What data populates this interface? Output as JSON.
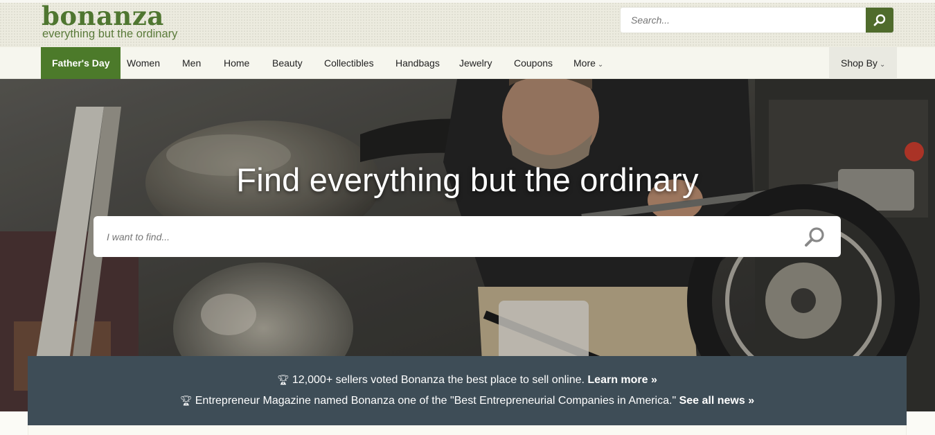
{
  "header": {
    "logo_word": "bonanza",
    "logo_tagline": "everything but the ordinary",
    "search_placeholder": "Search...",
    "search_button_icon": "search-icon"
  },
  "nav": {
    "items": [
      "Father's Day",
      "Women",
      "Men",
      "Home",
      "Beauty",
      "Collectibles",
      "Handbags",
      "Jewelry",
      "Coupons",
      "More"
    ],
    "shop_by": "Shop By"
  },
  "hero": {
    "title": "Find everything but the ordinary",
    "search_placeholder": "I want to find..."
  },
  "banner": {
    "line1_text": "12,000+ sellers voted Bonanza the best place to sell online.",
    "line1_link": "Learn more »",
    "line2_text": "Entrepreneur Magazine named Bonanza one of the \"Best Entrepreneurial Companies in America.\"",
    "line2_link": "See all news »",
    "icon": "trophy-icon"
  },
  "colors": {
    "brand_green": "#4c7a2a",
    "banner_bg": "#3e4d57"
  }
}
